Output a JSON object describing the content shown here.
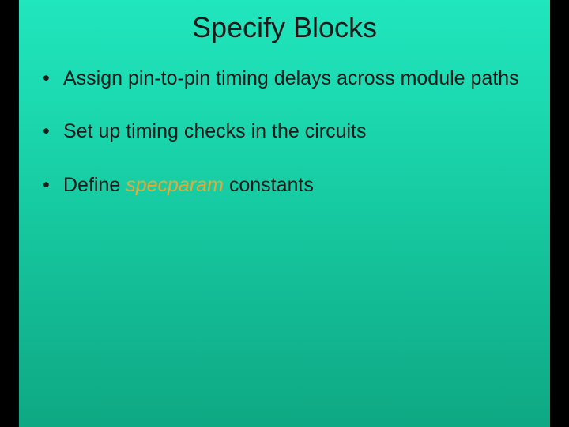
{
  "slide": {
    "title": "Specify Blocks",
    "bullets": [
      {
        "text_before": "Assign pin-to-pin timing delays across module paths",
        "keyword": "",
        "text_after": ""
      },
      {
        "text_before": "Set up timing checks in the circuits",
        "keyword": "",
        "text_after": ""
      },
      {
        "text_before": "Define ",
        "keyword": "specparam",
        "text_after": " constants"
      }
    ]
  }
}
